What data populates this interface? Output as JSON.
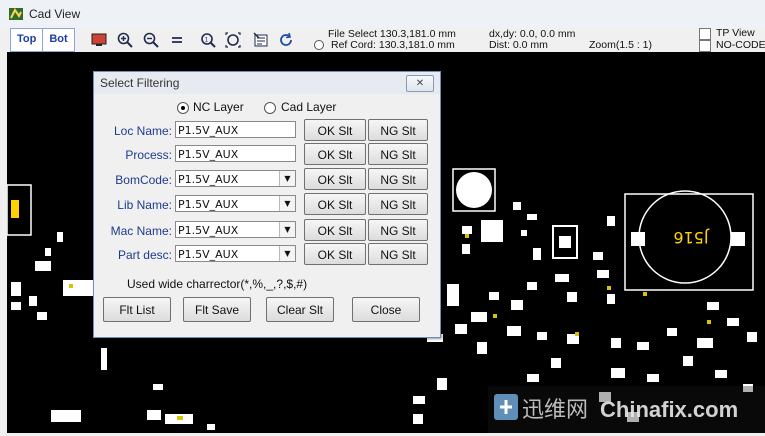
{
  "window": {
    "title": "Cad View"
  },
  "toolbar": {
    "top_label": "Top",
    "bot_label": "Bot",
    "file_select": "File Select 130.3,181.0 mm",
    "ref_cord": "Ref Cord: 130.3,181.0 mm",
    "dxdy": "dx,dy: 0.0, 0.0 mm",
    "dist": "Dist: 0.0 mm",
    "zoom": "Zoom(1.5 : 1)",
    "tp_view": "TP View",
    "no_code": "NO-CODE"
  },
  "canvas": {
    "component_label": "J516"
  },
  "dialog": {
    "title": "Select Filtering",
    "close_glyph": "✕",
    "radio_nc": "NC Layer",
    "radio_cad": "Cad Layer",
    "rows": [
      {
        "label": "Loc Name:",
        "value": "P1.5V_AUX",
        "ok": "OK Slt",
        "ng": "NG Slt"
      },
      {
        "label": "Process:",
        "value": "P1.5V_AUX",
        "ok": "OK Slt",
        "ng": "NG Slt"
      },
      {
        "label": "BomCode:",
        "value": "P1.5V_AUX",
        "ok": "OK Slt",
        "ng": "NG Slt"
      },
      {
        "label": "Lib Name:",
        "value": "P1.5V_AUX",
        "ok": "OK Slt",
        "ng": "NG Slt"
      },
      {
        "label": "Mac Name:",
        "value": "P1.5V_AUX",
        "ok": "OK Slt",
        "ng": "NG Slt"
      },
      {
        "label": "Part desc:",
        "value": "P1.5V_AUX",
        "ok": "OK Slt",
        "ng": "NG Slt"
      }
    ],
    "hint": "Used wide charrector(*,%,_,?,$,#)",
    "buttons": {
      "flt_list": "Flt List",
      "flt_save": "Flt Save",
      "clear_slt": "Clear Slt",
      "close": "Close"
    }
  },
  "watermark": {
    "cn": "迅维网",
    "en": "Chinafix.com"
  },
  "colors": {
    "canvas_bg": "#000000",
    "pad": "#ffffff",
    "accent_text": "#1e3a8c",
    "pad_yellow": "#d9c200"
  }
}
